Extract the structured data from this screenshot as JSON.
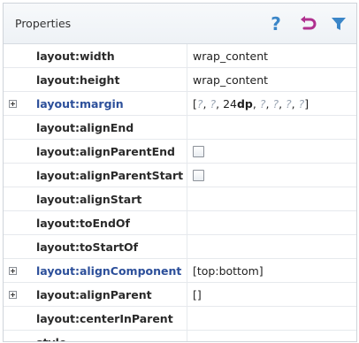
{
  "header": {
    "title": "Properties",
    "icons": [
      "help-icon",
      "undo-icon",
      "filter-icon"
    ],
    "help_glyph": "?",
    "accent": "#3b86c8",
    "undo_color": "#b0308f"
  },
  "rows": [
    {
      "name": "layout:width",
      "value": "wrap_content"
    },
    {
      "name": "layout:height",
      "value": "wrap_content"
    },
    {
      "name": "layout:margin",
      "value_parts": {
        "open": "[",
        "unset": "?",
        "sep": ", ",
        "num": "24",
        "unit": "dp",
        "close": "]"
      }
    },
    {
      "name": "layout:alignEnd",
      "value": ""
    },
    {
      "name": "layout:alignParentEnd",
      "value": "checkbox-unchecked"
    },
    {
      "name": "layout:alignParentStart",
      "value": "checkbox-unchecked"
    },
    {
      "name": "layout:alignStart",
      "value": ""
    },
    {
      "name": "layout:toEndOf",
      "value": ""
    },
    {
      "name": "layout:toStartOf",
      "value": ""
    },
    {
      "name": "layout:alignComponent",
      "value": "[top:bottom]"
    },
    {
      "name": "layout:alignParent",
      "value": "[]"
    },
    {
      "name": "layout:centerInParent",
      "value": ""
    },
    {
      "name": "style",
      "value": ""
    }
  ]
}
